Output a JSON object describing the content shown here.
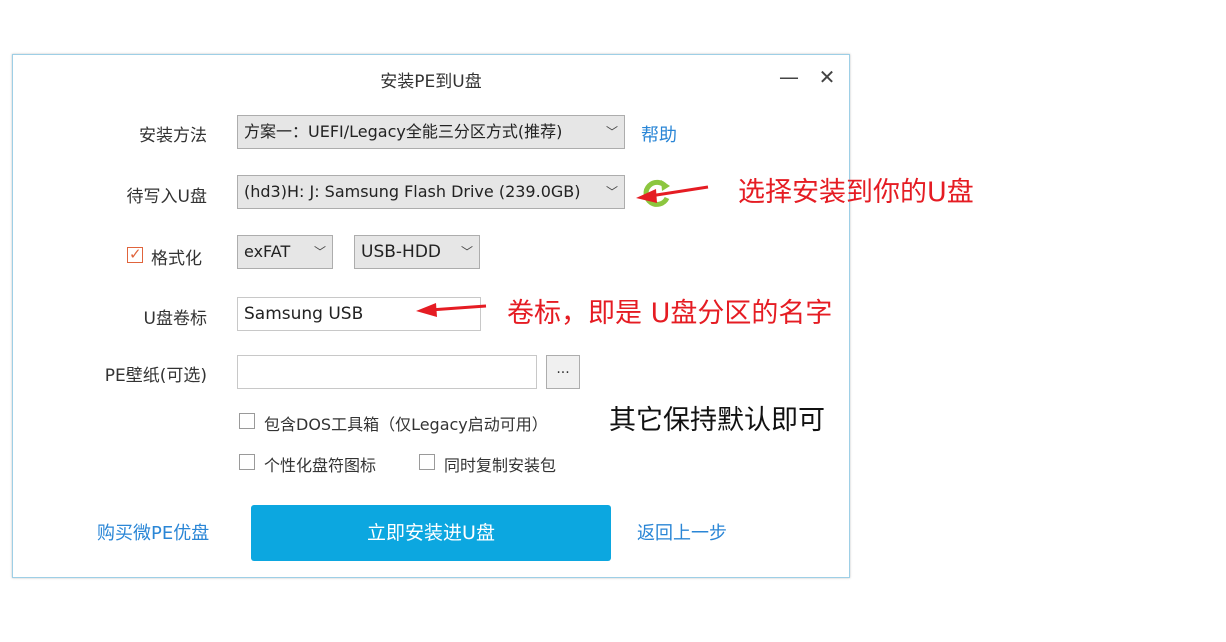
{
  "window": {
    "title": "安装PE到U盘",
    "minimize_symbol": "—",
    "close_symbol": "✕"
  },
  "form": {
    "install_method_label": "安装方法",
    "install_method_value": "方案一：UEFI/Legacy全能三分区方式(推荐)",
    "help_link": "帮助",
    "target_disk_label": "待写入U盘",
    "target_disk_value": "(hd3)H: J: Samsung Flash Drive (239.0GB)",
    "format_label": "格式化",
    "format_checked": true,
    "filesystem_value": "exFAT",
    "boot_mode_value": "USB-HDD",
    "volume_label_label": "U盘卷标",
    "volume_label_value": "Samsung USB",
    "wallpaper_label": "PE壁纸(可选)",
    "wallpaper_value": "",
    "browse_label": "...",
    "include_dos_label": "包含DOS工具箱（仅Legacy启动可用）",
    "include_dos_checked": false,
    "personalize_icon_label": "个性化盘符图标",
    "personalize_icon_checked": false,
    "copy_package_label": "同时复制安装包",
    "copy_package_checked": false
  },
  "footer": {
    "buy_link": "购买微PE优盘",
    "install_button": "立即安装进U盘",
    "back_link": "返回上一步"
  },
  "annotations": {
    "select_usb": "选择安装到你的U盘",
    "volume_label_note": "卷标，即是 U盘分区的名字",
    "keep_default": "其它保持默认即可",
    "arrow_color": "#e51c23"
  },
  "icons": {
    "refresh": "refresh-icon",
    "dropdown": "chevron-down-icon"
  }
}
